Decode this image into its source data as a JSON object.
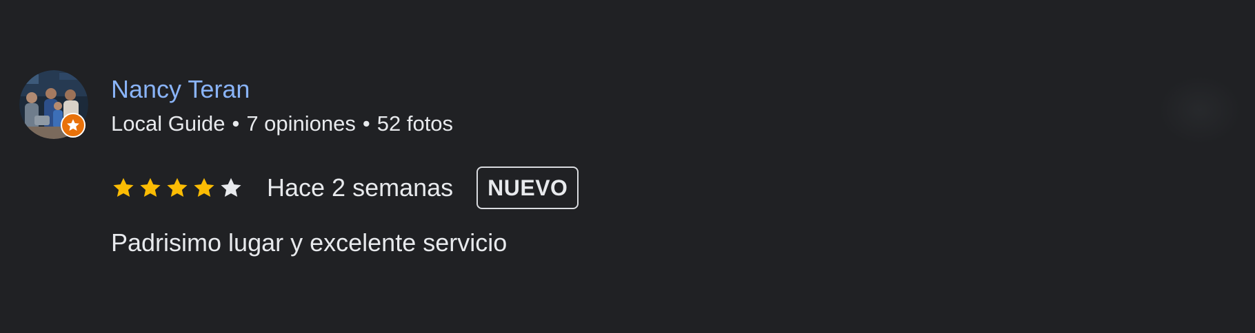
{
  "review": {
    "author": {
      "name": "Nancy Teran",
      "badge": "Local Guide",
      "sep1": "•",
      "reviews": "7 opiniones",
      "sep2": "•",
      "photos": "52 fotos",
      "avatar_icon": "profile-photo",
      "guide_badge_icon": "star-badge-icon"
    },
    "rating": {
      "value": 4,
      "max": 5,
      "filled_color": "#fbbc04",
      "empty_color": "#e8eaed"
    },
    "date": "Hace 2 semanas",
    "new_label": "NUEVO",
    "text": "Padrisimo lugar y excelente servicio"
  },
  "colors": {
    "background": "#202124",
    "name": "#8ab4f8",
    "text": "#e8eaed",
    "badge_orange": "#e8710a"
  }
}
